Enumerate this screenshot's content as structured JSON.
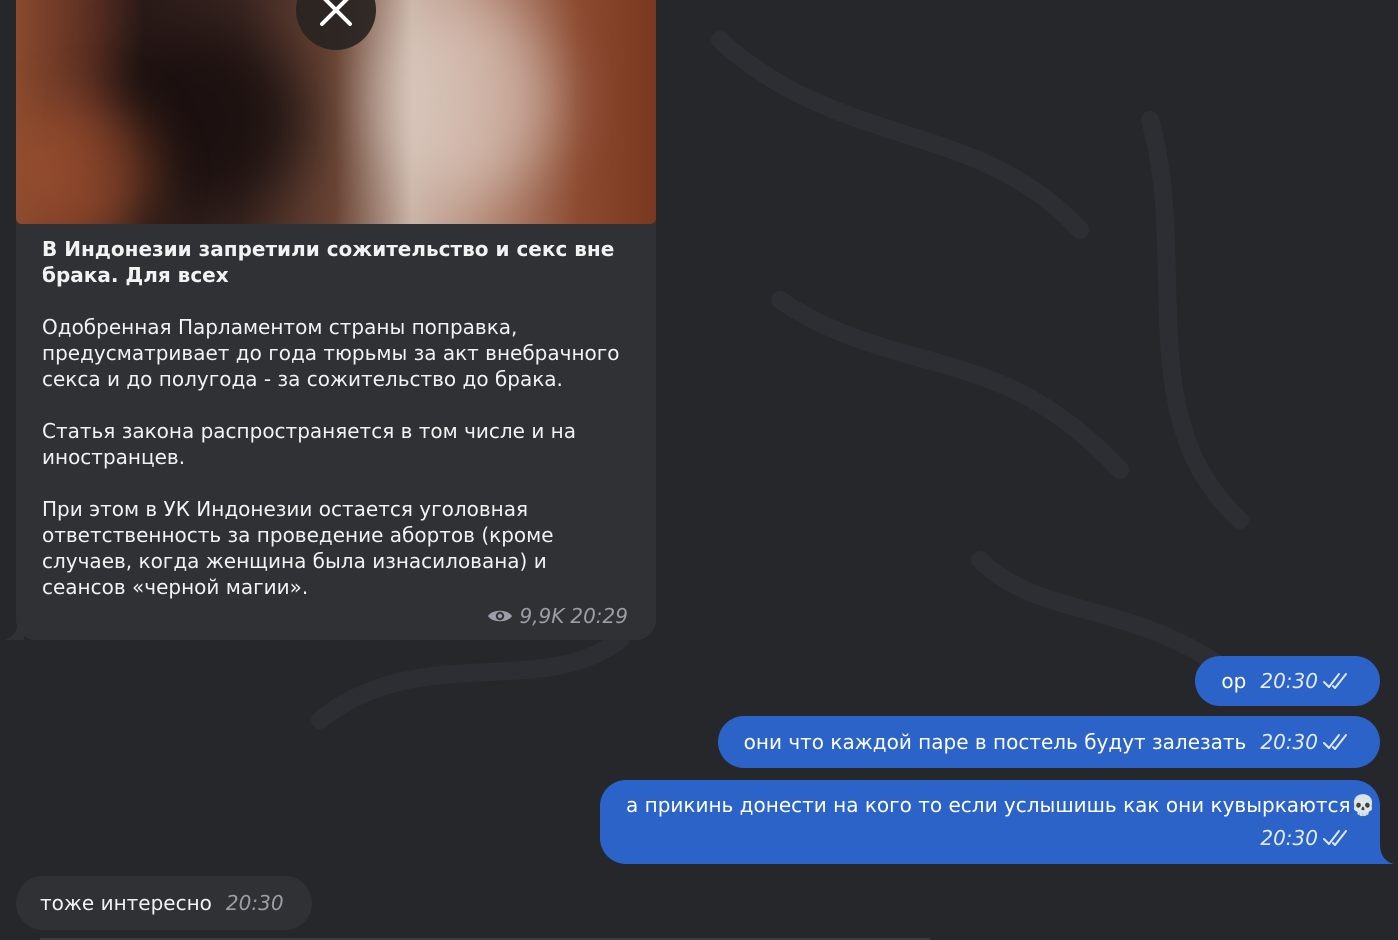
{
  "theme": {
    "background": "#25272b",
    "incoming_bubble": "#303135",
    "outgoing_bubble": "#2b63c9"
  },
  "post": {
    "media_close_icon": "close-icon",
    "title": "В Индонезии запретили сожительство и секс вне брака. Для всех",
    "paragraphs": [
      "Одобренная Парламентом страны поправка, предусматривает до года тюрьмы за акт внебрачного секса и до полугода - за сожительство до брака.",
      "Статья закона распространяется в том числе и на иностранцев.",
      "При этом в УК Индонезии остается уголовная ответственность за проведение абортов (кроме случаев, когда женщина была изнасилована) и сеансов «черной магии»."
    ],
    "views": "9,9K",
    "time": "20:29"
  },
  "messages": [
    {
      "direction": "out",
      "text": "ор",
      "time": "20:30",
      "status_icon": "double-check-icon"
    },
    {
      "direction": "out",
      "text": "они что каждой паре в постель будут залезать",
      "time": "20:30",
      "status_icon": "double-check-icon"
    },
    {
      "direction": "out",
      "text": "а прикинь донести на кого то если услышишь как они кувыркаются",
      "emoji": "💀",
      "time": "20:30",
      "status_icon": "double-check-icon"
    },
    {
      "direction": "in",
      "text": "тоже интересно",
      "time": "20:30"
    }
  ]
}
